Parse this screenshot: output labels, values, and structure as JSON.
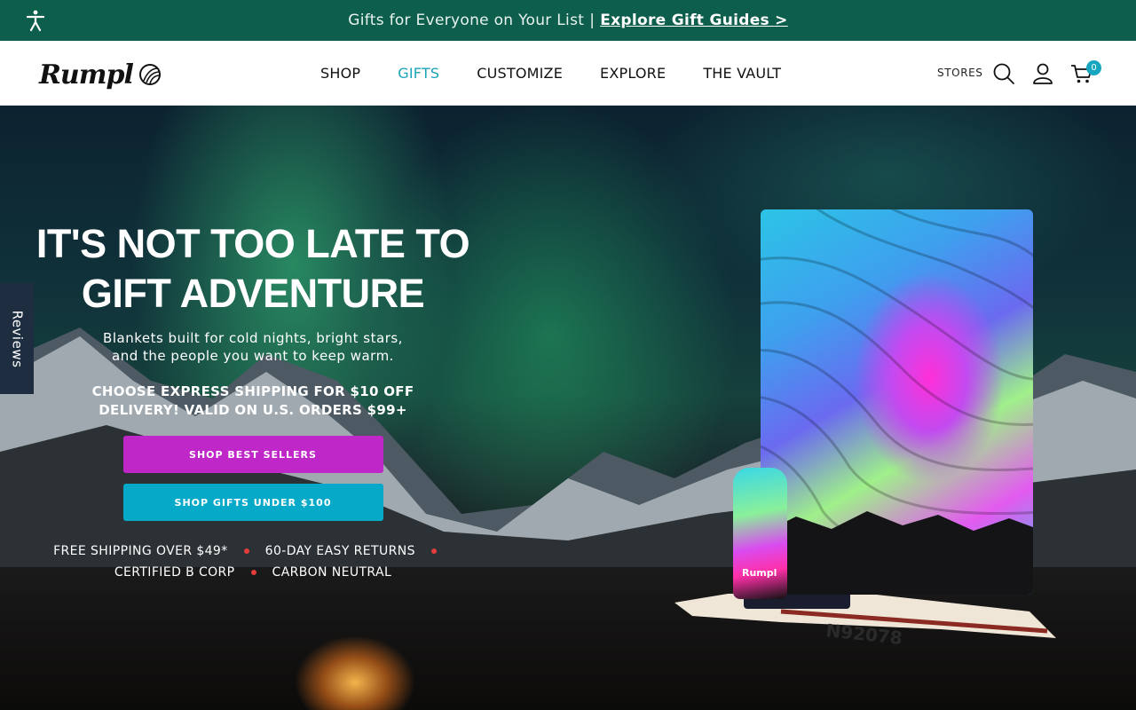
{
  "announcement": {
    "text": "Gifts for Everyone on Your List",
    "separator": "|",
    "link_label": "Explore Gift Guides >"
  },
  "brand": {
    "name": "Rumpl"
  },
  "nav": {
    "items": [
      {
        "label": "SHOP"
      },
      {
        "label": "GIFTS"
      },
      {
        "label": "CUSTOMIZE"
      },
      {
        "label": "EXPLORE"
      },
      {
        "label": "THE VAULT"
      }
    ],
    "active_color": "#1aa3b8"
  },
  "header": {
    "stores_label": "STORES",
    "cart_count": "0",
    "icons": [
      "search-icon",
      "account-icon",
      "cart-icon"
    ]
  },
  "reviews_tab": {
    "label": "Reviews"
  },
  "hero": {
    "headline_line1": "IT'S NOT TOO LATE TO",
    "headline_line2": "GIFT ADVENTURE",
    "sub_line1": "Blankets built for cold nights, bright stars,",
    "sub_line2": "and the people you want to keep warm.",
    "promo_line1": "CHOOSE EXPRESS SHIPPING FOR $10 OFF",
    "promo_line2": "DELIVERY! VALID ON U.S. ORDERS $99+",
    "button_primary": "SHOP BEST SELLERS",
    "button_secondary": "SHOP GIFTS UNDER $100",
    "badges_row1": [
      "FREE SHIPPING OVER $49*",
      "60-DAY EASY RETURNS"
    ],
    "badges_row2": [
      "CERTIFIED B CORP",
      "CARBON NEUTRAL"
    ],
    "bottle_logo": "Rumpl",
    "plane_registration": "N92078"
  },
  "colors": {
    "announcement_bg": "#0d5e4c",
    "primary_button": "#c027c8",
    "secondary_button": "#07a9c9",
    "badge_dot": "#e43b3b"
  }
}
